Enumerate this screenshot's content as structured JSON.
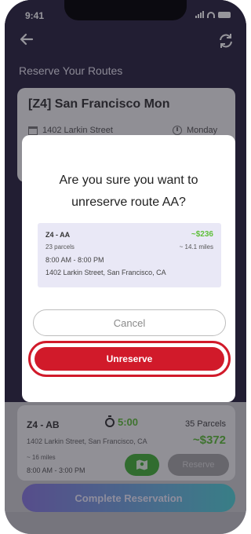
{
  "status_bar": {
    "time": "9:41"
  },
  "header": {
    "title": "Reserve Your Routes"
  },
  "route_card": {
    "name": "[Z4] San Francisco Mon",
    "address": "1402 Larkin Street",
    "day": "Monday"
  },
  "modal": {
    "question_line1": "Are you sure you want to",
    "question_line2": "unreserve route AA?",
    "route": {
      "name": "Z4 - AA",
      "price": "~$236",
      "parcels": "23 parcels",
      "miles": "~ 14.1 miles",
      "hours": "8:00 AM - 8:00 PM",
      "address": "1402 Larkin Street, San Francisco, CA"
    },
    "cancel_label": "Cancel",
    "unreserve_label": "Unreserve"
  },
  "route_ab": {
    "name": "Z4 - AB",
    "timer": "5:00",
    "parcels": "35 Parcels",
    "address": "1402 Larkin Street, San Francisco, CA",
    "price": "~$372",
    "miles": "~ 16 miles",
    "hours": "8:00 AM - 3:00 PM",
    "reserve_label": "Reserve"
  },
  "footer": {
    "complete_label": "Complete Reservation"
  },
  "colors": {
    "accent_green": "#5fbf3a",
    "danger_red": "#d11a2a",
    "header_bg": "#2b2540"
  },
  "icons": [
    "back-arrow-icon",
    "refresh-icon",
    "building-icon",
    "clock-icon",
    "stopwatch-icon",
    "map-icon"
  ]
}
